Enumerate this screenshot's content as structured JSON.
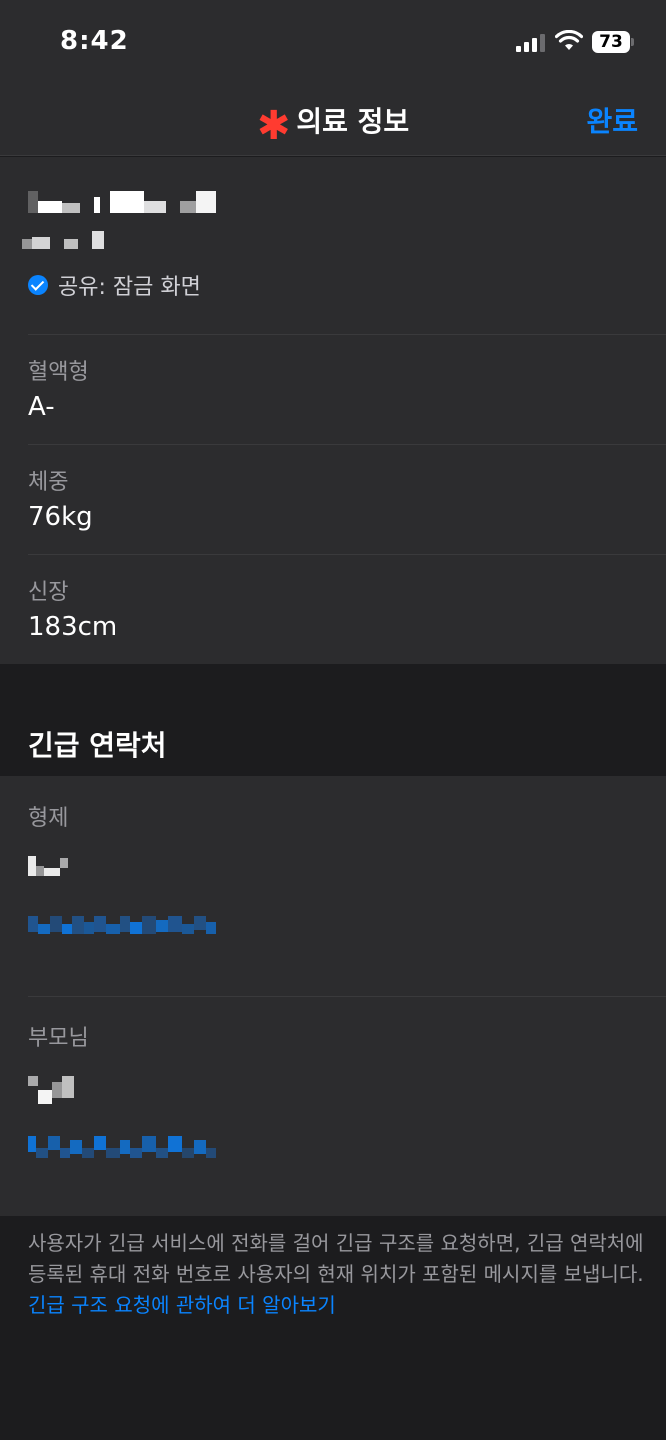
{
  "status_bar": {
    "time": "8:42",
    "battery": "73"
  },
  "nav": {
    "title": "의료 정보",
    "title_icon": "asterisk-icon",
    "done_label": "완료"
  },
  "profile": {
    "shared_label": "공유: 잠금 화면"
  },
  "fields": [
    {
      "label": "혈액형",
      "value": "A-"
    },
    {
      "label": "체중",
      "value": "76kg"
    },
    {
      "label": "신장",
      "value": "183cm"
    }
  ],
  "emergency": {
    "section_title": "긴급 연락처",
    "contacts": [
      {
        "relation": "형제"
      },
      {
        "relation": "부모님"
      }
    ]
  },
  "footer": {
    "text": "사용자가 긴급 서비스에 전화를 걸어 긴급 구조를 요청하면, 긴급 연락처에 등록된 휴대 전화 번호로 사용자의 현재 위치가 포함된 메시지를 보냅니다. ",
    "link": "긴급 구조 요청에 관하여 더 알아보기"
  },
  "colors": {
    "accent": "#0a84ff",
    "asterisk": "#ff3b30",
    "background": "#1c1c1e",
    "card": "#2c2c2e"
  }
}
